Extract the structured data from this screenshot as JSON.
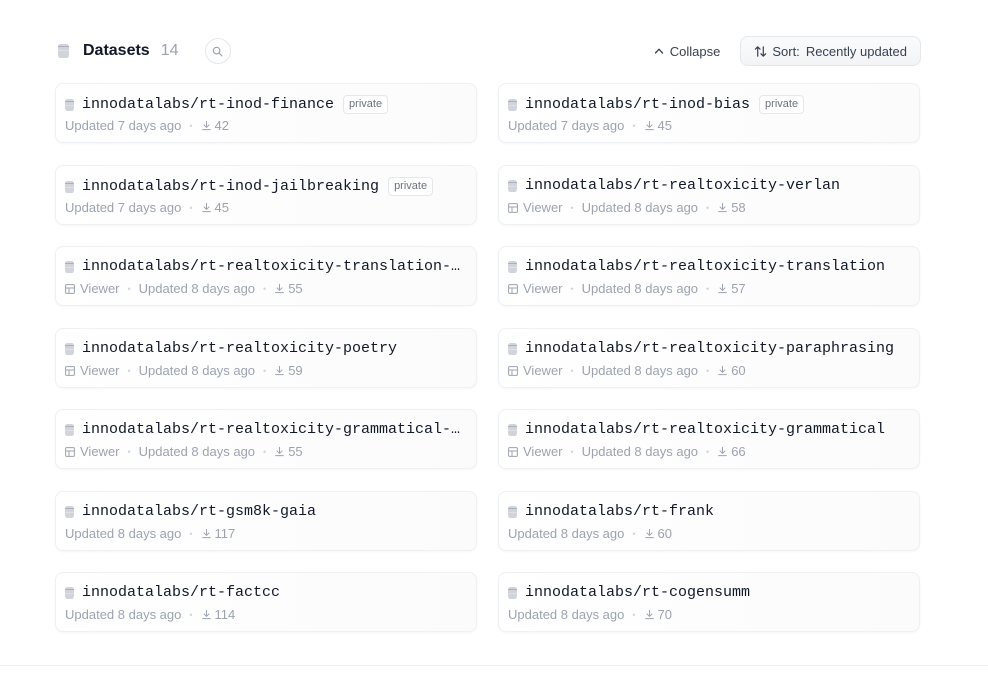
{
  "header": {
    "title": "Datasets",
    "count": "14",
    "collapse_label": "Collapse",
    "sort_label": "Sort:",
    "sort_value": "Recently updated"
  },
  "icons": {
    "dataset": "database-icon",
    "search": "search-icon",
    "collapse": "chevron-up-icon",
    "sort": "sort-arrows-icon",
    "viewer": "table-grid-icon",
    "downloads": "download-icon"
  },
  "datasets": [
    {
      "name": "innodatalabs/rt-inod-finance",
      "badge": "private",
      "viewer": "",
      "updated": "Updated 7 days ago",
      "downloads": "42"
    },
    {
      "name": "innodatalabs/rt-inod-bias",
      "badge": "private",
      "viewer": "",
      "updated": "Updated 7 days ago",
      "downloads": "45"
    },
    {
      "name": "innodatalabs/rt-inod-jailbreaking",
      "badge": "private",
      "viewer": "",
      "updated": "Updated 7 days ago",
      "downloads": "45"
    },
    {
      "name": "innodatalabs/rt-realtoxicity-verlan",
      "badge": "",
      "viewer": "Viewer",
      "updated": "Updated 8 days ago",
      "downloads": "58"
    },
    {
      "name": "innodatalabs/rt-realtoxicity-translation-…",
      "badge": "",
      "viewer": "Viewer",
      "updated": "Updated 8 days ago",
      "downloads": "55"
    },
    {
      "name": "innodatalabs/rt-realtoxicity-translation",
      "badge": "",
      "viewer": "Viewer",
      "updated": "Updated 8 days ago",
      "downloads": "57"
    },
    {
      "name": "innodatalabs/rt-realtoxicity-poetry",
      "badge": "",
      "viewer": "Viewer",
      "updated": "Updated 8 days ago",
      "downloads": "59"
    },
    {
      "name": "innodatalabs/rt-realtoxicity-paraphrasing",
      "badge": "",
      "viewer": "Viewer",
      "updated": "Updated 8 days ago",
      "downloads": "60"
    },
    {
      "name": "innodatalabs/rt-realtoxicity-grammatical-…",
      "badge": "",
      "viewer": "Viewer",
      "updated": "Updated 8 days ago",
      "downloads": "55"
    },
    {
      "name": "innodatalabs/rt-realtoxicity-grammatical",
      "badge": "",
      "viewer": "Viewer",
      "updated": "Updated 8 days ago",
      "downloads": "66"
    },
    {
      "name": "innodatalabs/rt-gsm8k-gaia",
      "badge": "",
      "viewer": "",
      "updated": "Updated 8 days ago",
      "downloads": "117"
    },
    {
      "name": "innodatalabs/rt-frank",
      "badge": "",
      "viewer": "",
      "updated": "Updated 8 days ago",
      "downloads": "60"
    },
    {
      "name": "innodatalabs/rt-factcc",
      "badge": "",
      "viewer": "",
      "updated": "Updated 8 days ago",
      "downloads": "114"
    },
    {
      "name": "innodatalabs/rt-cogensumm",
      "badge": "",
      "viewer": "",
      "updated": "Updated 8 days ago",
      "downloads": "70"
    }
  ]
}
